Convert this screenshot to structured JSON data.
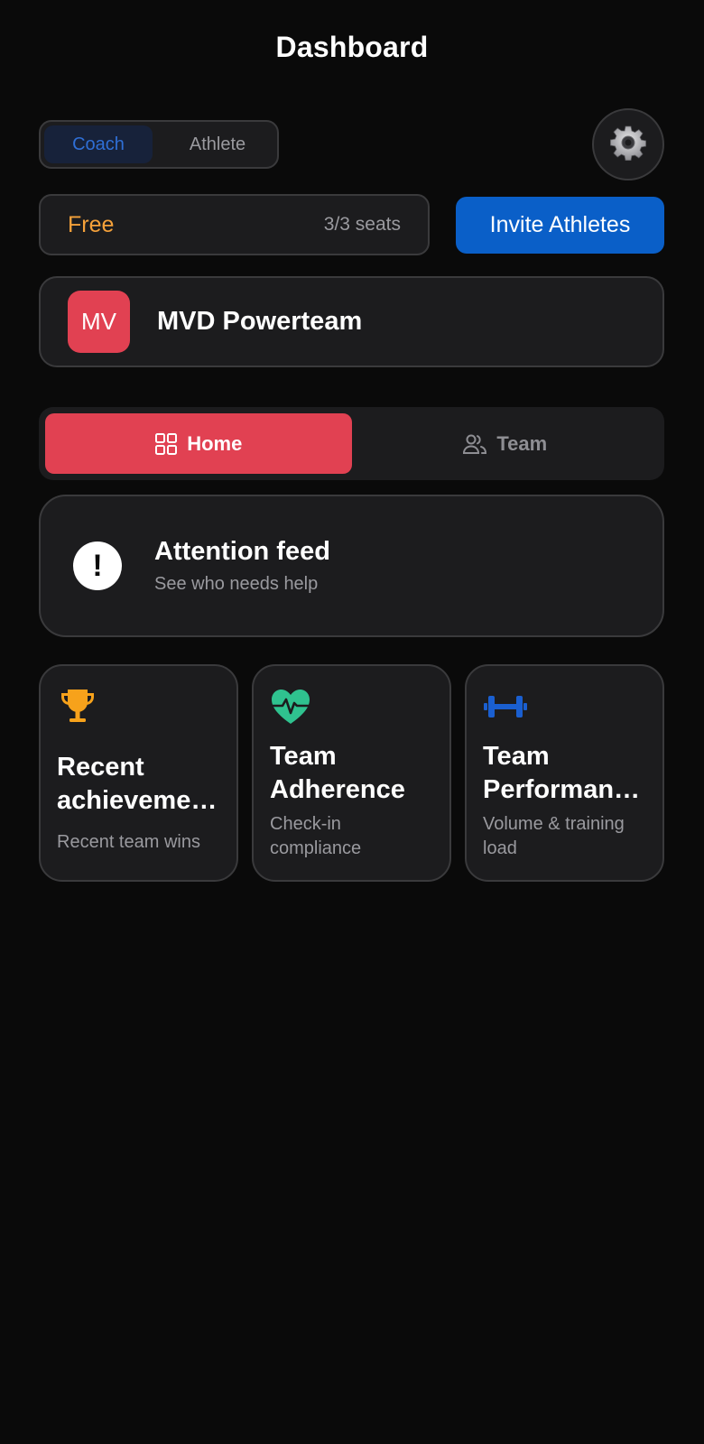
{
  "header": {
    "title": "Dashboard"
  },
  "role_toggle": {
    "options": [
      "Coach",
      "Athlete"
    ],
    "selected": "Coach"
  },
  "settings": {
    "icon": "gear-icon"
  },
  "plan": {
    "name": "Free",
    "seats": "3/3 seats",
    "invite_label": "Invite Athletes"
  },
  "team": {
    "avatar_initials": "MV",
    "name": "MVD Powerteam",
    "avatar_color": "#e14152"
  },
  "tabs": [
    {
      "label": "Home",
      "icon": "grid-icon",
      "active": true
    },
    {
      "label": "Team",
      "icon": "users-icon",
      "active": false
    }
  ],
  "attention": {
    "title": "Attention feed",
    "subtitle": "See who needs help",
    "icon": "exclamation-icon"
  },
  "cards": [
    {
      "title_lines": [
        "Recent",
        "achieveme…"
      ],
      "subtitle": "Recent team wins",
      "icon": "trophy-icon",
      "icon_color": "#f7a21b"
    },
    {
      "title_lines": [
        "Team",
        "Adherence"
      ],
      "subtitle": "Check-in compliance",
      "icon": "heartbeat-icon",
      "icon_color": "#2fc28f"
    },
    {
      "title_lines": [
        "Team",
        "Performan…"
      ],
      "subtitle": "Volume & training load",
      "icon": "dumbbell-icon",
      "icon_color": "#1a5fd0"
    }
  ],
  "colors": {
    "accent_red": "#e14152",
    "accent_blue": "#0a5fc8",
    "plan_orange": "#f5a13a"
  }
}
